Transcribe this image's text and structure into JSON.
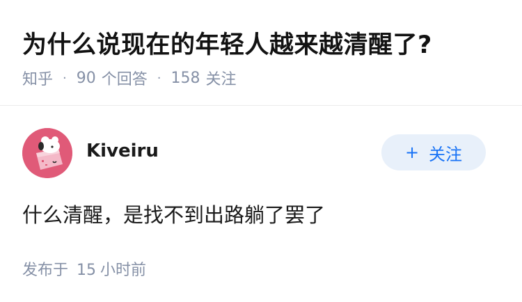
{
  "question": {
    "title": "为什么说现在的年轻人越来越清醒了?",
    "source": "知乎",
    "answer_count": "90",
    "answer_label": "个回答",
    "follower_count": "158",
    "follower_label": "关注"
  },
  "author": {
    "name": "Kiveiru",
    "follow_plus": "+",
    "follow_label": "关注",
    "avatar_color": "#e05a78"
  },
  "answer": {
    "text": "什么清醒，是找不到出路躺了罢了",
    "published_label": "发布于",
    "published_num": "15",
    "published_unit": "小时前"
  },
  "colors": {
    "accent": "#1772f6",
    "meta": "#8590a6",
    "follow_bg": "#e8f0fa"
  }
}
